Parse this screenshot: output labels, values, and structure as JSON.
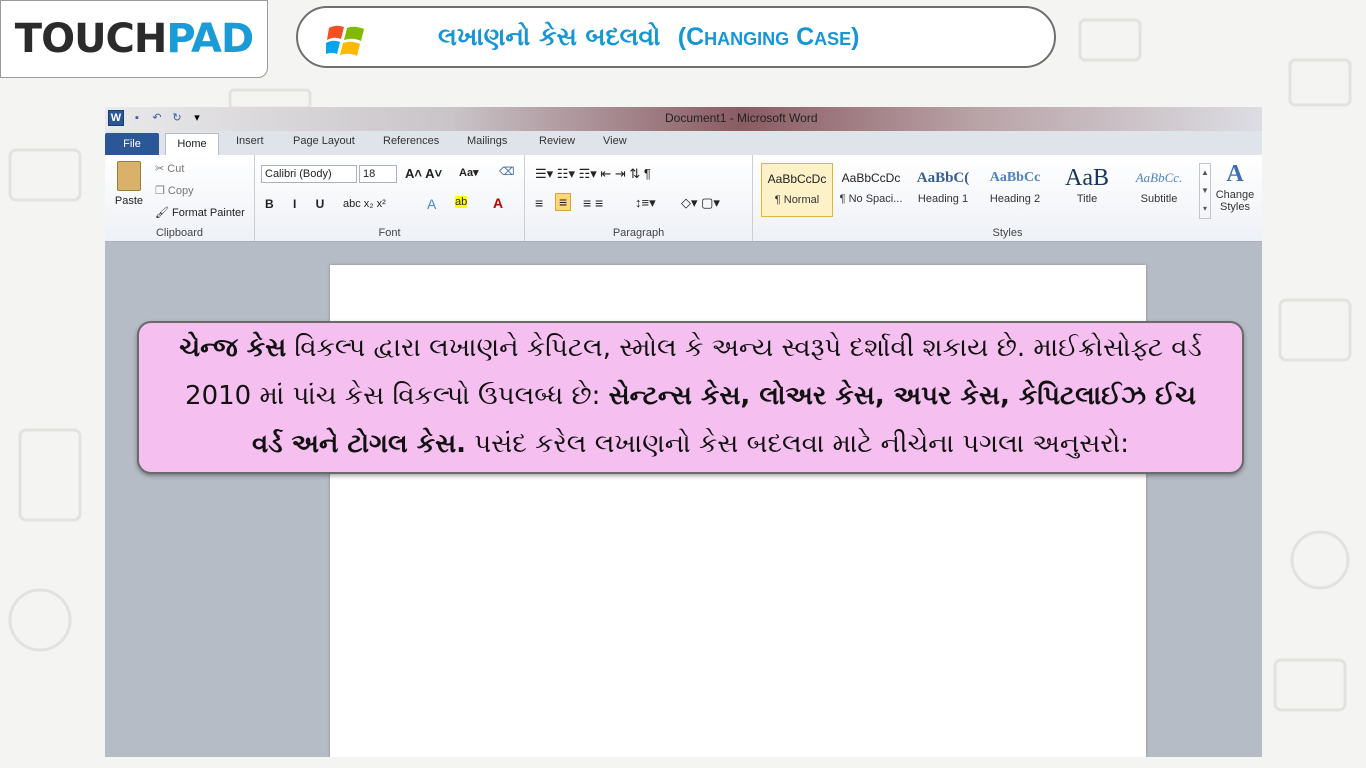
{
  "header": {
    "logo_part1": "TOUCH",
    "logo_part2": "PAD",
    "title_gujarati": "લખાણનો કેસ બદલવો",
    "title_english": "(Changing Case)"
  },
  "window": {
    "title": "Document1 - Microsoft Word",
    "tabs": [
      "File",
      "Home",
      "Insert",
      "Page Layout",
      "References",
      "Mailings",
      "Review",
      "View"
    ]
  },
  "ribbon": {
    "clipboard": {
      "label": "Clipboard",
      "paste": "Paste",
      "cut": "Cut",
      "copy": "Copy",
      "format_painter": "Format Painter"
    },
    "font": {
      "label": "Font",
      "name": "Calibri (Body)",
      "size": "18"
    },
    "paragraph": {
      "label": "Paragraph"
    },
    "styles": {
      "label": "Styles",
      "items": [
        {
          "sample": "AaBbCcDc",
          "name": "¶ Normal"
        },
        {
          "sample": "AaBbCcDc",
          "name": "¶ No Spaci..."
        },
        {
          "sample": "AaBbC(",
          "name": "Heading 1"
        },
        {
          "sample": "AaBbCc",
          "name": "Heading 2"
        },
        {
          "sample": "AaB",
          "name": "Title"
        },
        {
          "sample": "AaBbCc.",
          "name": "Subtitle"
        }
      ],
      "change_styles": "Change Styles"
    }
  },
  "info": {
    "line1_bold": "ચેન્જ કેસ",
    "line1_rest": " વિકલ્પ દ્વારા લખાણને કેપિટલ, સ્મોલ કે અન્ય સ્વરૂપે દર્શાવી શકાય છે. માઈક્રોસોફ્ટ વર્ડ",
    "line2_plain": "2010 માં પાંચ કેસ  વિકલ્પો ઉપલબ્ધ છે: ",
    "line2_bold": "સેન્ટન્સ કેસ, લોઅર કેસ, અપર કેસ, કેપિટલાઈઝ ઈચ",
    "line3_bold": "વર્ડ અને ટોગલ કેસ.",
    "line3_rest": " પસંદ કરેલ લખાણનો કેસ બદલવા માટે નીચેના પગલા અનુસરો:"
  },
  "colors": {
    "accent": "#1696d4",
    "info_bg": "#f5c0f0",
    "file_tab": "#2b5797"
  }
}
